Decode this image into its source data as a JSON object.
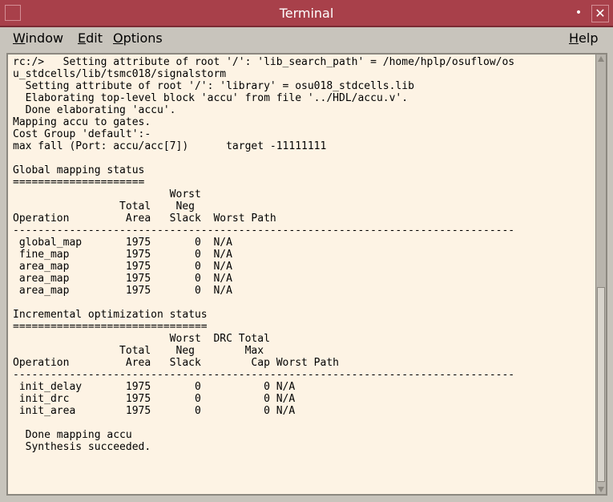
{
  "window": {
    "title": "Terminal"
  },
  "menu": {
    "window": {
      "first": "W",
      "rest": "indow"
    },
    "edit": {
      "first": "E",
      "rest": "dit"
    },
    "options": {
      "first": "O",
      "rest": "ptions"
    },
    "help": {
      "first": "H",
      "rest": "elp"
    }
  },
  "terminal": {
    "lines": [
      "rc:/>   Setting attribute of root '/': 'lib_search_path' = /home/hplp/osuflow/os",
      "u_stdcells/lib/tsmc018/signalstorm",
      "  Setting attribute of root '/': 'library' = osu018_stdcells.lib",
      "  Elaborating top-level block 'accu' from file '../HDL/accu.v'.",
      "  Done elaborating 'accu'.",
      "Mapping accu to gates.",
      "Cost Group 'default':-",
      "max fall (Port: accu/acc[7])      target -11111111",
      "",
      "Global mapping status",
      "=====================",
      "                         Worst",
      "                 Total    Neg",
      "Operation         Area   Slack  Worst Path",
      "--------------------------------------------------------------------------------",
      " global_map       1975       0  N/A",
      " fine_map         1975       0  N/A",
      " area_map         1975       0  N/A",
      " area_map         1975       0  N/A",
      " area_map         1975       0  N/A",
      "",
      "Incremental optimization status",
      "===============================",
      "                         Worst  DRC Total",
      "                 Total    Neg        Max",
      "Operation         Area   Slack        Cap Worst Path",
      "--------------------------------------------------------------------------------",
      " init_delay       1975       0          0 N/A",
      " init_drc         1975       0          0 N/A",
      " init_area        1975       0          0 N/A",
      "",
      "  Done mapping accu",
      "  Synthesis succeeded."
    ]
  },
  "icons": {
    "window_menu": "window-menu-icon",
    "dot": "minimize-dot-icon",
    "close": "close-icon",
    "scroll_up": "scroll-up-arrow-icon",
    "scroll_down": "scroll-down-arrow-icon"
  },
  "glyphs": {
    "dot": "•",
    "close": "✕"
  }
}
